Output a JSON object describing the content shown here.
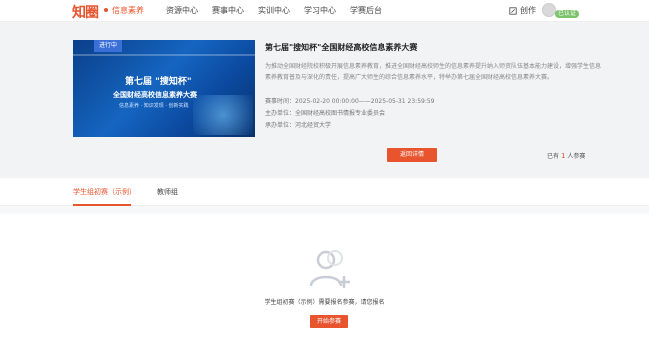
{
  "header": {
    "logo": "知圈",
    "logo_sub": "信息素养",
    "nav": [
      "资源中心",
      "赛事中心",
      "实训中心",
      "学习中心",
      "学赛后台"
    ],
    "create": "创作",
    "verified": "已认证"
  },
  "contest": {
    "cover": {
      "status_tag": "进行中",
      "line1": "第七届 \"搜知杯\"",
      "line2": "全国财经高校信息素养大赛",
      "line3": "信息素养 · 知识发现 · 创新实践"
    },
    "title": "第七届\"搜知杯\"全国财经高校信息素养大赛",
    "description": "为推动全国财经院校积极开展信息素养教育，推进全国财经高校师生的信息素养提升纳入师资队伍基本能力建设，增强学生信息素养教育普及与深化的责任，提高广大师生的综合信息素养水平，特举办第七届全国财经高校信息素养大赛。",
    "time_label": "赛事时间",
    "time_value": "2025-02-20 00:00:00——2025-05-31 23:59:59",
    "organizer_label": "主办单位",
    "organizer_value": "全国财经高校图书情报专业委员会",
    "host_label": "承办单位",
    "host_value": "河北经贸大学",
    "back_button": "返回详情",
    "joined_prefix": "已有",
    "joined_count": "1",
    "joined_suffix": "人参赛"
  },
  "tabs": [
    "学生组初赛（示例）",
    "教师组"
  ],
  "empty": {
    "message": "学生组初赛（示例）需要报名参赛，请您报名",
    "join_button": "开始参赛"
  },
  "colors": {
    "accent": "#e8542e",
    "verified": "#7cc36b"
  }
}
